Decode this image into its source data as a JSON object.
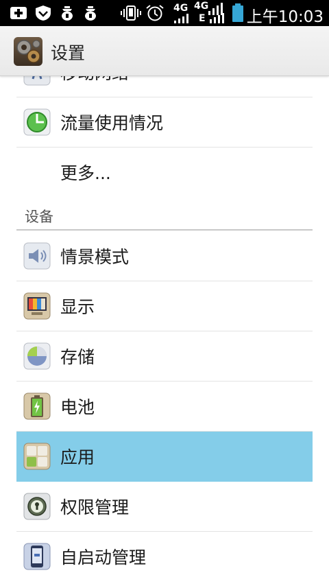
{
  "status_bar": {
    "time": "上午10:03",
    "network1": "4G",
    "network2": "4G",
    "network2_sub": "E",
    "icons": [
      "add-notification-icon",
      "shield-icon",
      "download-icon",
      "download-icon",
      "vibrate-icon",
      "alarm-icon",
      "signal-icon",
      "signal-icon",
      "battery-icon"
    ]
  },
  "action_bar": {
    "title": "设置",
    "icon": "settings-gear-icon"
  },
  "list": {
    "partial_item": {
      "label": "移动网络",
      "icon": "mobile-network-icon"
    },
    "items_top": [
      {
        "label": "流量使用情况",
        "icon": "data-usage-icon"
      },
      {
        "label": "更多...",
        "icon": ""
      }
    ],
    "section_device": "设备",
    "items_device": [
      {
        "label": "情景模式",
        "icon": "speaker-icon"
      },
      {
        "label": "显示",
        "icon": "display-icon"
      },
      {
        "label": "存储",
        "icon": "storage-icon"
      },
      {
        "label": "电池",
        "icon": "battery-icon"
      },
      {
        "label": "应用",
        "icon": "apps-icon"
      },
      {
        "label": "权限管理",
        "icon": "permission-lock-icon"
      },
      {
        "label": "自启动管理",
        "icon": "autostart-icon"
      }
    ]
  },
  "colors": {
    "selected_row": "#84cde9",
    "status_bar": "#000000",
    "action_bar": "#efefef"
  }
}
